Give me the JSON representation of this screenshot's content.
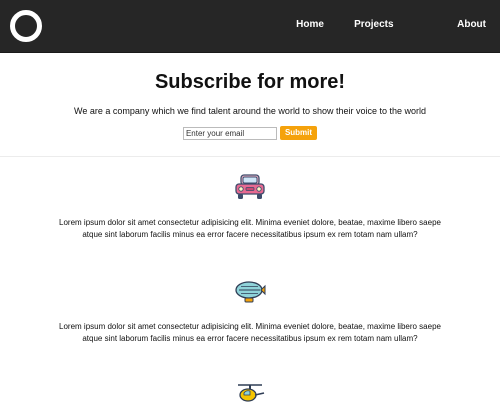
{
  "nav": {
    "logo_icon": "ring-logo-icon",
    "links": [
      {
        "label": "Home"
      },
      {
        "label": "Projects"
      },
      {
        "label": "About"
      }
    ]
  },
  "subscribe": {
    "title": "Subscribe for more!",
    "subtitle": "We are a company which we find talent around the world to show their voice to the world",
    "email_placeholder": "Enter your email",
    "submit_label": "Submit"
  },
  "features": [
    {
      "icon": "car-icon",
      "text": "Lorem ipsum dolor sit amet consectetur adipisicing elit. Minima eveniet dolore, beatae, maxime libero saepe atque sint laborum facilis minus ea error facere necessitatibus ipsum ex rem totam nam ullam?"
    },
    {
      "icon": "airship-icon",
      "text": "Lorem ipsum dolor sit amet consectetur adipisicing elit. Minima eveniet dolore, beatae, maxime libero saepe atque sint laborum facilis minus ea error facere necessitatibus ipsum ex rem totam nam ullam?"
    },
    {
      "icon": "helicopter-icon"
    }
  ],
  "colors": {
    "navbar": "#262626",
    "accent": "#f5a20b"
  }
}
